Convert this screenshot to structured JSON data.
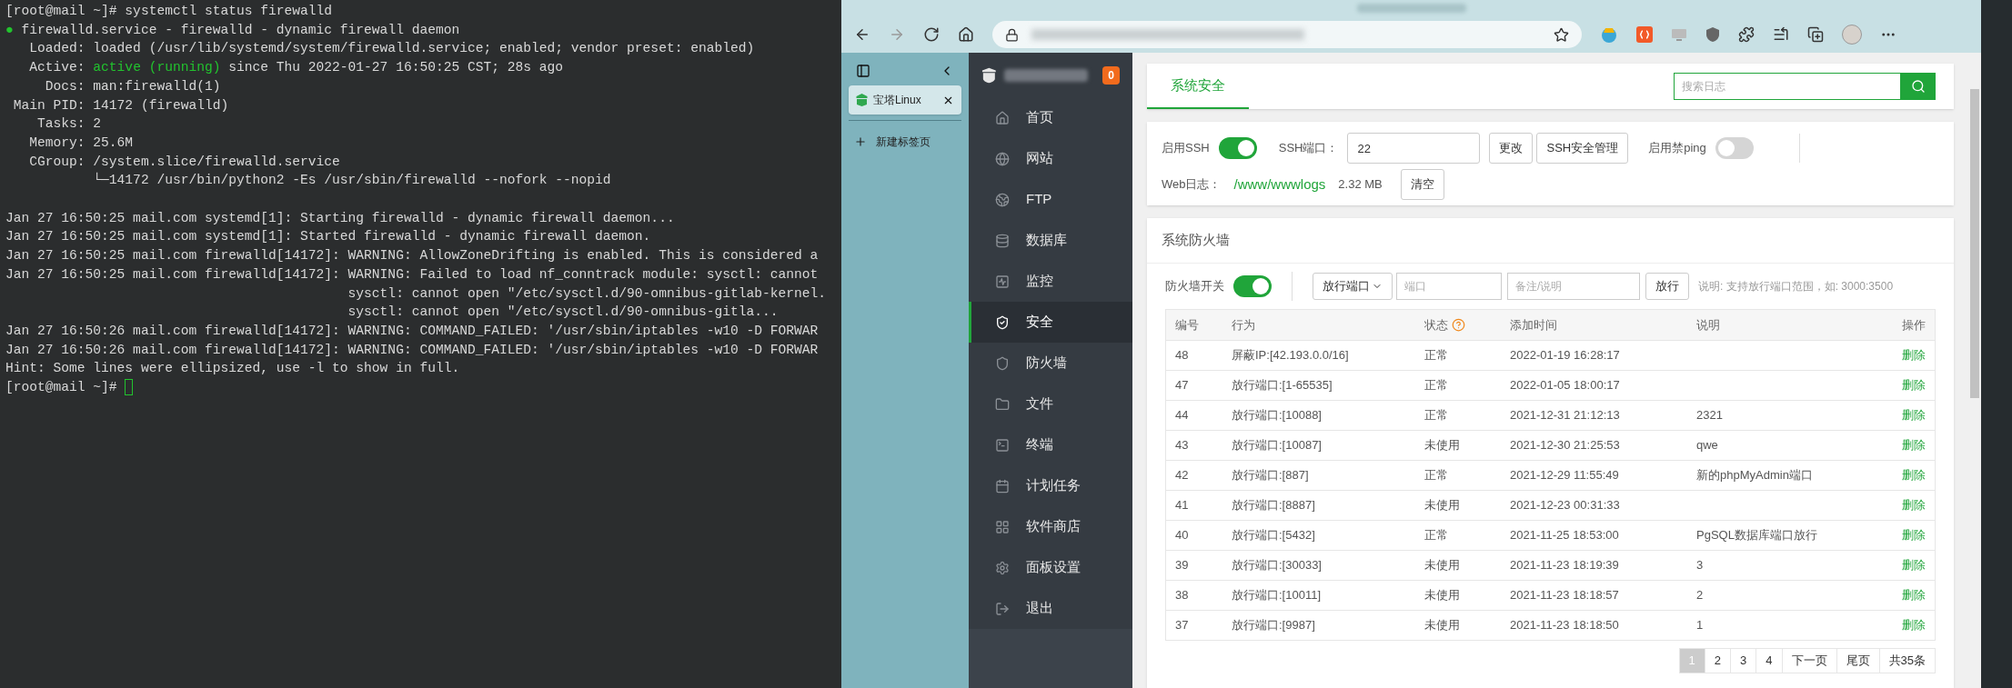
{
  "terminal": {
    "lines": [
      {
        "kind": "text",
        "text": "[root@mail ~]# systemctl status firewalld"
      },
      {
        "kind": "text",
        "parts": [
          {
            "text": "●",
            "highlighted": true
          },
          {
            "text": " firewalld.service - firewalld - dynamic firewall daemon",
            "highlighted": false
          }
        ]
      },
      {
        "kind": "text",
        "text": "   Loaded: loaded (/usr/lib/systemd/system/firewalld.service; enabled; vendor preset: enabled)"
      },
      {
        "kind": "text",
        "parts": [
          {
            "text": "   Active: ",
            "highlighted": false
          },
          {
            "text": "active (running)",
            "highlighted": true
          },
          {
            "text": " since Thu 2022-01-27 16:50:25 CST; 28s ago",
            "highlighted": false
          }
        ]
      },
      {
        "kind": "text",
        "text": "     Docs: man:firewalld(1)"
      },
      {
        "kind": "text",
        "text": " Main PID: 14172 (firewalld)"
      },
      {
        "kind": "text",
        "text": "    Tasks: 2"
      },
      {
        "kind": "text",
        "text": "   Memory: 25.6M"
      },
      {
        "kind": "text",
        "text": "   CGroup: /system.slice/firewalld.service"
      },
      {
        "kind": "text",
        "text": "           └─14172 /usr/bin/python2 -Es /usr/sbin/firewalld --nofork --nopid"
      },
      {
        "kind": "blank"
      },
      {
        "kind": "text",
        "text": "Jan 27 16:50:25 mail.com systemd[1]: Starting firewalld - dynamic firewall daemon..."
      },
      {
        "kind": "text",
        "text": "Jan 27 16:50:25 mail.com systemd[1]: Started firewalld - dynamic firewall daemon."
      },
      {
        "kind": "text",
        "text": "Jan 27 16:50:25 mail.com firewalld[14172]: WARNING: AllowZoneDrifting is enabled. This is considered a"
      },
      {
        "kind": "text",
        "text": "Jan 27 16:50:25 mail.com firewalld[14172]: WARNING: Failed to load nf_conntrack module: sysctl: cannot"
      },
      {
        "kind": "text",
        "text": "                                           sysctl: cannot open \"/etc/sysctl.d/90-omnibus-gitlab-kernel."
      },
      {
        "kind": "text",
        "text": "                                           sysctl: cannot open \"/etc/sysctl.d/90-omnibus-gitla..."
      },
      {
        "kind": "text",
        "text": "Jan 27 16:50:26 mail.com firewalld[14172]: WARNING: COMMAND_FAILED: '/usr/sbin/iptables -w10 -D FORWAR"
      },
      {
        "kind": "text",
        "text": "Jan 27 16:50:26 mail.com firewalld[14172]: WARNING: COMMAND_FAILED: '/usr/sbin/iptables -w10 -D FORWAR"
      },
      {
        "kind": "text",
        "text": "Hint: Some lines were ellipsized, use -l to show in full."
      },
      {
        "kind": "prompt",
        "text": "[root@mail ~]# "
      }
    ]
  },
  "browser": {
    "vertical_tabs": {
      "tabs": [
        {
          "label": "宝塔Linux",
          "selected": true
        }
      ],
      "new_tab": "新建标签页"
    },
    "panel": {
      "notification_count": "0",
      "menu": [
        {
          "label": "首页",
          "selected": false
        },
        {
          "label": "网站",
          "selected": false
        },
        {
          "label": "FTP",
          "selected": false
        },
        {
          "label": "数据库",
          "selected": false
        },
        {
          "label": "监控",
          "selected": false
        },
        {
          "label": "安全",
          "selected": true
        },
        {
          "label": "防火墙",
          "selected": false
        },
        {
          "label": "文件",
          "selected": false
        },
        {
          "label": "终端",
          "selected": false
        },
        {
          "label": "计划任务",
          "selected": false
        },
        {
          "label": "软件商店",
          "selected": false
        },
        {
          "label": "面板设置",
          "selected": false
        },
        {
          "label": "退出",
          "selected": false
        }
      ]
    },
    "security": {
      "tab": "系统安全",
      "search_placeholder": "搜索日志",
      "ssh": {
        "label": "启用SSH",
        "on": true
      },
      "ssh_port_label": "SSH端口：",
      "ssh_port": "22",
      "change_button": "更改",
      "ssh_manage_button": "SSH安全管理",
      "ping": {
        "label": "启用禁ping",
        "on": false
      },
      "web_log_label": "Web日志：",
      "web_log_path": "/www/wwwlogs",
      "web_log_size": "2.32 MB",
      "clear_button": "清空"
    },
    "firewall": {
      "title": "系统防火墙",
      "switch": {
        "label": "防火墙开关",
        "on": true
      },
      "action_select": "放行端口",
      "port_placeholder": "端口",
      "note_placeholder": "备注/说明",
      "submit_button": "放行",
      "hint": "说明: 支持放行端口范围，如: 3000:3500",
      "table": {
        "columns": [
          "编号",
          "行为",
          "状态",
          "添加时间",
          "说明",
          "操作"
        ],
        "rows": [
          {
            "id": "48",
            "action": "屏蔽IP:[42.193.0.0/16]",
            "status": "正常",
            "time": "2022-01-19 16:28:17",
            "op": "删除"
          },
          {
            "id": "47",
            "action": "放行端口:[1-65535]",
            "status": "正常",
            "time": "2022-01-05 18:00:17",
            "op": "删除"
          },
          {
            "id": "44",
            "action": "放行端口:[10088]",
            "status": "正常",
            "time": "2021-12-31 21:12:13",
            "note": "2321",
            "op": "删除"
          },
          {
            "id": "43",
            "action": "放行端口:[10087]",
            "status": "未使用",
            "time": "2021-12-30 21:25:53",
            "note": "qwe",
            "op": "删除"
          },
          {
            "id": "42",
            "action": "放行端口:[887]",
            "status": "正常",
            "time": "2021-12-29 11:55:49",
            "note": "新的phpMyAdmin端口",
            "op": "删除"
          },
          {
            "id": "41",
            "action": "放行端口:[8887]",
            "status": "未使用",
            "time": "2021-12-23 00:31:33",
            "op": "删除"
          },
          {
            "id": "40",
            "action": "放行端口:[5432]",
            "status": "正常",
            "time": "2021-11-25 18:53:00",
            "note": "PgSQL数据库端口放行",
            "op": "删除"
          },
          {
            "id": "39",
            "action": "放行端口:[30033]",
            "status": "未使用",
            "time": "2021-11-23 18:19:39",
            "note": "3",
            "op": "删除"
          },
          {
            "id": "38",
            "action": "放行端口:[10011]",
            "status": "未使用",
            "time": "2021-11-23 18:18:57",
            "note": "2",
            "op": "删除"
          },
          {
            "id": "37",
            "action": "放行端口:[9987]",
            "status": "未使用",
            "time": "2021-11-23 18:18:50",
            "note": "1",
            "op": "删除"
          }
        ]
      },
      "pagination": [
        {
          "label": "1",
          "selected": true
        },
        {
          "label": "2",
          "selected": false
        },
        {
          "label": "3",
          "selected": false
        },
        {
          "label": "4",
          "selected": false
        },
        {
          "label": "下一页",
          "selected": false
        },
        {
          "label": "尾页",
          "selected": false
        },
        {
          "label": "共35条",
          "selected": false
        }
      ]
    }
  }
}
